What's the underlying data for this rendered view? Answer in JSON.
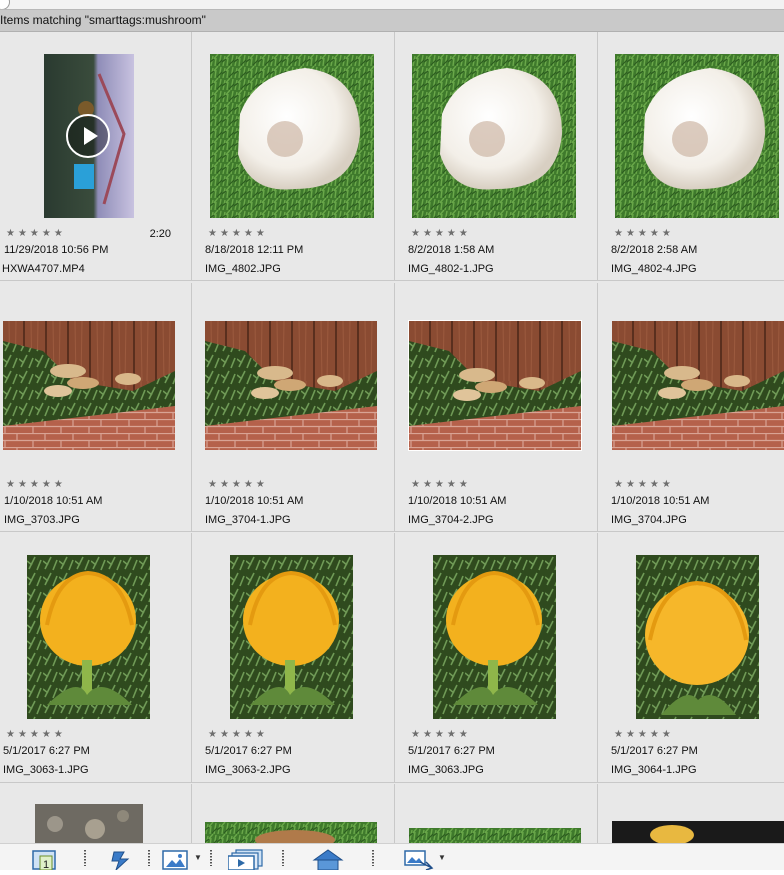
{
  "header": {
    "title": "Items matching \"smarttags:mushroom\""
  },
  "colors": {
    "header_bg": "#c9c9c9",
    "grid_bg": "#e8e8e8",
    "star": "#6e6e6e"
  },
  "items": [
    {
      "date": "11/29/2018 10:56 PM",
      "filename": "HXWA4707.MP4",
      "stars": "★★★★★",
      "duration": "2:20",
      "type": "video"
    },
    {
      "date": "8/18/2018 12:11 PM",
      "filename": "IMG_4802.JPG",
      "stars": "★★★★★",
      "type": "mushroom-grass"
    },
    {
      "date": "8/2/2018 1:58 AM",
      "filename": "IMG_4802-1.JPG",
      "stars": "★★★★★",
      "type": "mushroom-grass"
    },
    {
      "date": "8/2/2018 2:58 AM",
      "filename": "IMG_4802-4.JPG",
      "stars": "★★★★★",
      "type": "mushroom-grass"
    },
    {
      "date": "1/10/2018 10:51 AM",
      "filename": "IMG_3703.JPG",
      "stars": "★★★★★",
      "type": "mushroom-fence"
    },
    {
      "date": "1/10/2018 10:51 AM",
      "filename": "IMG_3704-1.JPG",
      "stars": "★★★★★",
      "type": "mushroom-fence"
    },
    {
      "date": "1/10/2018 10:51 AM",
      "filename": "IMG_3704-2.JPG",
      "stars": "★★★★★",
      "type": "mushroom-fence"
    },
    {
      "date": "1/10/2018 10:51 AM",
      "filename": "IMG_3704.JPG",
      "stars": "★★★★★",
      "type": "mushroom-fence"
    },
    {
      "date": "5/1/2017 6:27 PM",
      "filename": "IMG_3063-1.JPG",
      "stars": "★★★★★",
      "type": "protea"
    },
    {
      "date": "5/1/2017 6:27 PM",
      "filename": "IMG_3063-2.JPG",
      "stars": "★★★★★",
      "type": "protea"
    },
    {
      "date": "5/1/2017 6:27 PM",
      "filename": "IMG_3063.JPG",
      "stars": "★★★★★",
      "type": "protea"
    },
    {
      "date": "5/1/2017 6:27 PM",
      "filename": "IMG_3064-1.JPG",
      "stars": "★★★★★",
      "type": "protea"
    }
  ],
  "toolbar": {
    "buttons": [
      {
        "name": "page-number-icon",
        "label": "1"
      },
      {
        "name": "flash-icon"
      },
      {
        "name": "image-edit-icon"
      },
      {
        "name": "slideshow-icon"
      },
      {
        "name": "home-icon"
      },
      {
        "name": "share-icon"
      }
    ]
  }
}
